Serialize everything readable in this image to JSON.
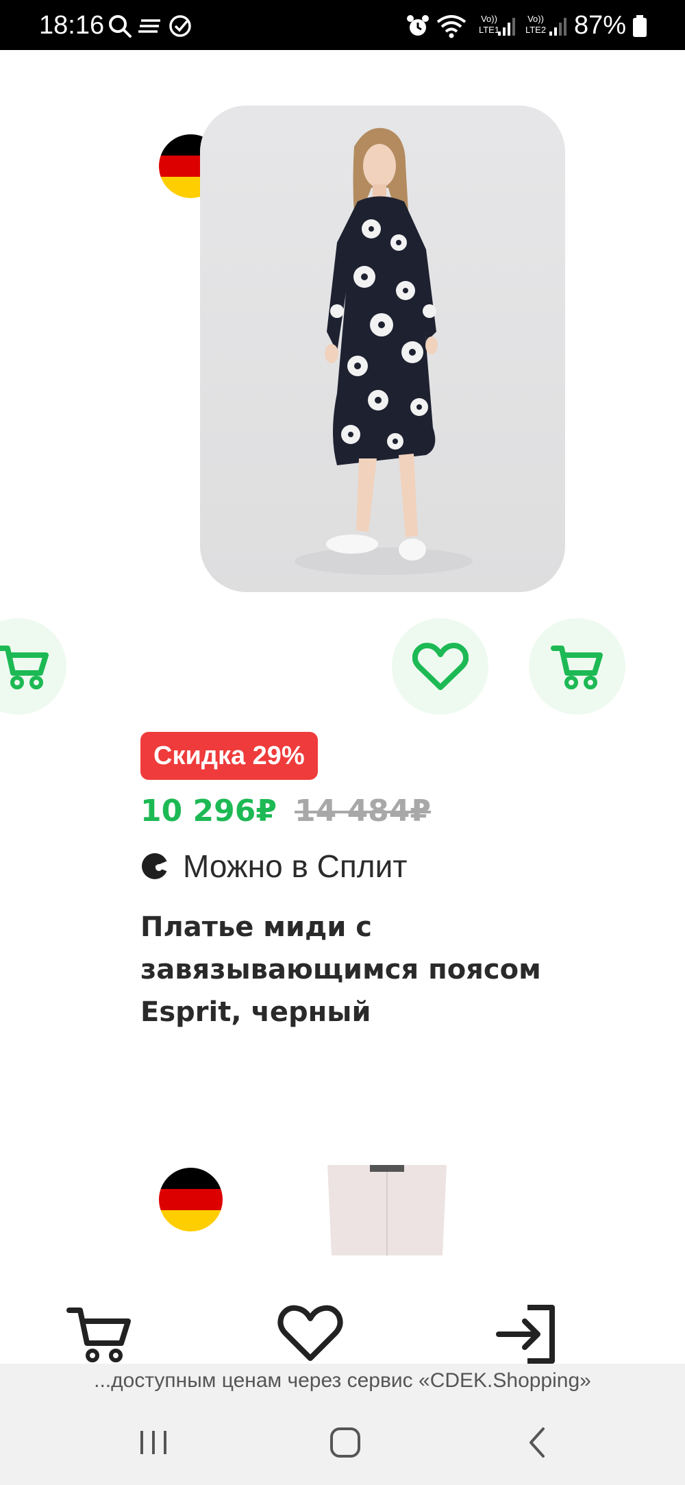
{
  "status_bar": {
    "time": "18:16",
    "battery_percent": "87%",
    "sim1_label": "LTE1",
    "sim2_label": "LTE2",
    "volte_label": "Vo))"
  },
  "product": {
    "origin_flag": "germany-flag",
    "image_alt": "woman in black dress with white floral print",
    "discount_badge": "Скидка 29%",
    "price_current": "10 296₽",
    "price_old": "14 484₽",
    "split_text": "Можно в Сплит",
    "title_lines": [
      "Платье миди с",
      "завязывающимся поясом",
      "Esprit, черный"
    ]
  },
  "actions": {
    "favorite_icon": "heart-icon",
    "cart_icon": "cart-icon"
  },
  "bottom_nav": {
    "items": [
      "cart-icon",
      "heart-icon",
      "login-icon"
    ]
  },
  "banner_text": "...доступным ценам через сервис «CDEK.Shopping»",
  "colors": {
    "accent_green": "#1db954",
    "discount_red": "#ef3b3b",
    "soft_green_bg": "#eefaf0"
  }
}
